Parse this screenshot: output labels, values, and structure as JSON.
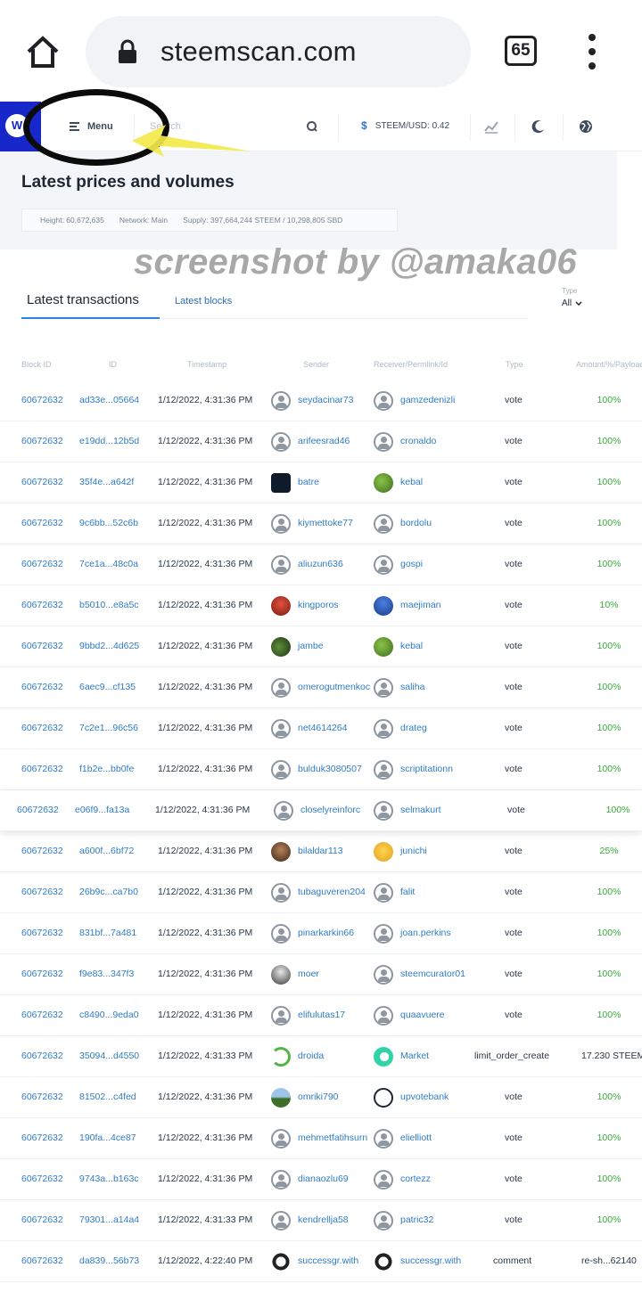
{
  "browser": {
    "url": "steemscan.com",
    "tab_count": "65"
  },
  "nav": {
    "logo_text": "W",
    "menu_label": "Menu",
    "search_placeholder": "Search",
    "price_text": "STEEM/USD: 0.42"
  },
  "header": {
    "title": "Latest prices and volumes",
    "height": "Height: 60,672,635",
    "network": "Network: Main",
    "supply": "Supply: 397,664,244 STEEM / 10,298,805 SBD"
  },
  "watermark": "screenshot by @amaka06",
  "tabs": {
    "transactions": "Latest transactions",
    "blocks": "Latest blocks"
  },
  "filter": {
    "label": "Type",
    "value": "All"
  },
  "columns": {
    "block": "Block ID",
    "id": "ID",
    "timestamp": "Timestamp",
    "sender": "Sender",
    "receiver": "Receiver/Permlink/Id",
    "type": "Type",
    "amount": "Amount/%/Payload"
  },
  "colors": {
    "brand": "#1727c9",
    "link": "#2f7cc7",
    "positive": "#38a93c"
  },
  "rows": [
    {
      "block": "60672632",
      "id": "ad33e...05664",
      "time": "1/12/2022, 4:31:36 PM",
      "sender": "seydacinar73",
      "sender_avatar": "default",
      "receiver": "gamzedenizli",
      "receiver_avatar": "default",
      "type": "vote",
      "amount": "100%"
    },
    {
      "block": "60672632",
      "id": "e19dd...12b5d",
      "time": "1/12/2022, 4:31:36 PM",
      "sender": "arifeesrad46",
      "sender_avatar": "default",
      "receiver": "cronaldo",
      "receiver_avatar": "default",
      "type": "vote",
      "amount": "100%"
    },
    {
      "block": "60672632",
      "id": "35f4e...a642f",
      "time": "1/12/2022, 4:31:36 PM",
      "sender": "batre",
      "sender_avatar": "dark",
      "receiver": "kebal",
      "receiver_avatar": "green",
      "type": "vote",
      "amount": "100%"
    },
    {
      "block": "60672632",
      "id": "9c6bb...52c6b",
      "time": "1/12/2022, 4:31:36 PM",
      "sender": "kiymettoke77",
      "sender_avatar": "default",
      "receiver": "bordolu",
      "receiver_avatar": "default",
      "type": "vote",
      "amount": "100%"
    },
    {
      "block": "60672632",
      "id": "7ce1a...48c0a",
      "time": "1/12/2022, 4:31:36 PM",
      "sender": "aliuzun636",
      "sender_avatar": "default",
      "receiver": "gospi",
      "receiver_avatar": "default",
      "type": "vote",
      "amount": "100%"
    },
    {
      "block": "60672632",
      "id": "b5010...e8a5c",
      "time": "1/12/2022, 4:31:36 PM",
      "sender": "kingporos",
      "sender_avatar": "red",
      "receiver": "maejiman",
      "receiver_avatar": "blue",
      "type": "vote",
      "amount": "10%"
    },
    {
      "block": "60672632",
      "id": "9bbd2...4d625",
      "time": "1/12/2022, 4:31:36 PM",
      "sender": "jambe",
      "sender_avatar": "forest",
      "receiver": "kebal",
      "receiver_avatar": "green",
      "type": "vote",
      "amount": "100%"
    },
    {
      "block": "60672632",
      "id": "6aec9...cf135",
      "time": "1/12/2022, 4:31:36 PM",
      "sender": "omerogutmenkoc",
      "sender_avatar": "default",
      "receiver": "saliha",
      "receiver_avatar": "default",
      "type": "vote",
      "amount": "100%"
    },
    {
      "block": "60672632",
      "id": "7c2e1...96c56",
      "time": "1/12/2022, 4:31:36 PM",
      "sender": "net4614264",
      "sender_avatar": "default",
      "receiver": "drateg",
      "receiver_avatar": "default",
      "type": "vote",
      "amount": "100%"
    },
    {
      "block": "60672632",
      "id": "f1b2e...bb0fe",
      "time": "1/12/2022, 4:31:36 PM",
      "sender": "bulduk3080507",
      "sender_avatar": "default",
      "receiver": "scriptitationn",
      "receiver_avatar": "default",
      "type": "vote",
      "amount": "100%"
    },
    {
      "block": "60672632",
      "id": "e06f9...fa13a",
      "time": "1/12/2022, 4:31:36 PM",
      "sender": "closelyreinforc",
      "sender_avatar": "default",
      "receiver": "selmakurt",
      "receiver_avatar": "default",
      "type": "vote",
      "amount": "100%",
      "highlight": true
    },
    {
      "block": "60672632",
      "id": "a600f...6bf72",
      "time": "1/12/2022, 4:31:36 PM",
      "sender": "bilaldar113",
      "sender_avatar": "brown",
      "receiver": "junichi",
      "receiver_avatar": "yellow",
      "type": "vote",
      "amount": "25%"
    },
    {
      "block": "60672632",
      "id": "26b9c...ca7b0",
      "time": "1/12/2022, 4:31:36 PM",
      "sender": "tubaguveren204",
      "sender_avatar": "default",
      "receiver": "falit",
      "receiver_avatar": "default",
      "type": "vote",
      "amount": "100%"
    },
    {
      "block": "60672632",
      "id": "831bf...7a481",
      "time": "1/12/2022, 4:31:36 PM",
      "sender": "pinarkarkin66",
      "sender_avatar": "default",
      "receiver": "joan.perkins",
      "receiver_avatar": "default",
      "type": "vote",
      "amount": "100%"
    },
    {
      "block": "60672632",
      "id": "f9e83...347f3",
      "time": "1/12/2022, 4:31:36 PM",
      "sender": "moer",
      "sender_avatar": "photo",
      "receiver": "steemcurator01",
      "receiver_avatar": "default",
      "type": "vote",
      "amount": "100%"
    },
    {
      "block": "60672632",
      "id": "c8490...9eda0",
      "time": "1/12/2022, 4:31:36 PM",
      "sender": "elifulutas17",
      "sender_avatar": "default",
      "receiver": "quaavuere",
      "receiver_avatar": "default",
      "type": "vote",
      "amount": "100%"
    },
    {
      "block": "60672632",
      "id": "35094...d4550",
      "time": "1/12/2022, 4:31:33 PM",
      "sender": "droida",
      "sender_avatar": "droida",
      "receiver": "Market",
      "receiver_avatar": "market",
      "type": "limit_order_create",
      "amount": "17.230 STEEM"
    },
    {
      "block": "60672632",
      "id": "81502...c4fed",
      "time": "1/12/2022, 4:31:36 PM",
      "sender": "omriki790",
      "sender_avatar": "landscape",
      "receiver": "upvotebank",
      "receiver_avatar": "bank",
      "type": "vote",
      "amount": "100%"
    },
    {
      "block": "60672632",
      "id": "190fa...4ce87",
      "time": "1/12/2022, 4:31:36 PM",
      "sender": "mehmetfatihsurn",
      "sender_avatar": "default",
      "receiver": "elielliott",
      "receiver_avatar": "default",
      "type": "vote",
      "amount": "100%"
    },
    {
      "block": "60672632",
      "id": "9743a...b163c",
      "time": "1/12/2022, 4:31:36 PM",
      "sender": "dianaozlu69",
      "sender_avatar": "default",
      "receiver": "cortezz",
      "receiver_avatar": "default",
      "type": "vote",
      "amount": "100%"
    },
    {
      "block": "60672632",
      "id": "79301...a14a4",
      "time": "1/12/2022, 4:31:33 PM",
      "sender": "kendrellja58",
      "sender_avatar": "default",
      "receiver": "patric32",
      "receiver_avatar": "default",
      "type": "vote",
      "amount": "100%"
    },
    {
      "block": "60672632",
      "id": "da839...56b73",
      "time": "1/12/2022, 4:22:40 PM",
      "sender": "successgr.with",
      "sender_avatar": "gwith",
      "receiver": "successgr.with",
      "receiver_avatar": "gwith",
      "type": "comment",
      "amount": "re-sh...62140"
    }
  ]
}
